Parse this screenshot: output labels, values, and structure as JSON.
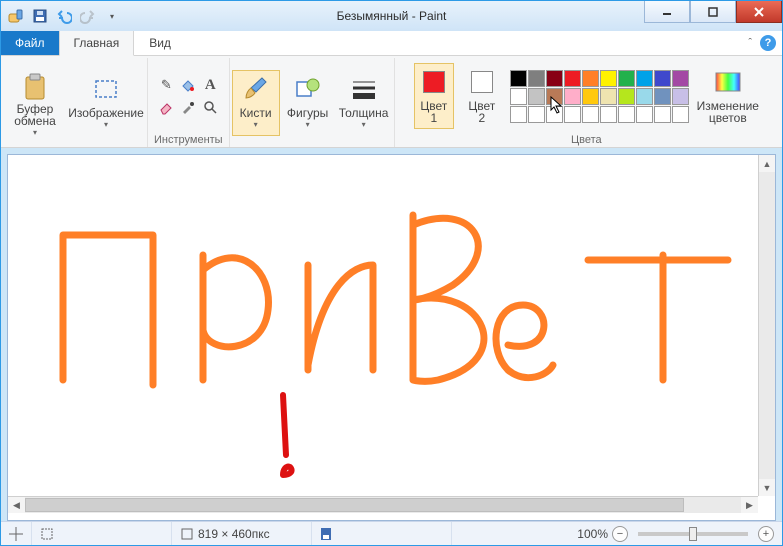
{
  "title": "Безымянный - Paint",
  "menu": {
    "file": "Файл",
    "tabs": [
      "Главная",
      "Вид"
    ],
    "active": 0
  },
  "ribbon": {
    "clipboard": {
      "label": "Буфер\nобмена"
    },
    "image": {
      "label": "Изображение"
    },
    "tools_group_label": "Инструменты",
    "brushes": {
      "label": "Кисти"
    },
    "shapes": {
      "label": "Фигуры"
    },
    "size": {
      "label": "Толщина"
    },
    "color1": {
      "label": "Цвет\n1",
      "value": "#ed1c24"
    },
    "color2": {
      "label": "Цвет\n2",
      "value": "#ffffff"
    },
    "edit_colors": {
      "label": "Изменение\nцветов"
    },
    "colors_group_label": "Цвета",
    "palette_row1": [
      "#000000",
      "#7f7f7f",
      "#880015",
      "#ed1c24",
      "#ff7f27",
      "#fff200",
      "#22b14c",
      "#00a2e8",
      "#3f48cc",
      "#a349a4"
    ],
    "palette_row2": [
      "#ffffff",
      "#c3c3c3",
      "#b97a57",
      "#ffaec9",
      "#ffc90e",
      "#efe4b0",
      "#b5e61d",
      "#99d9ea",
      "#7092be",
      "#c8bfe7"
    ],
    "palette_row3": [
      "#ffffff",
      "#ffffff",
      "#ffffff",
      "#ffffff",
      "#ffffff",
      "#ffffff",
      "#ffffff",
      "#ffffff",
      "#ffffff",
      "#ffffff"
    ]
  },
  "status": {
    "dimensions": "819 × 460пкс",
    "zoom": "100%"
  }
}
